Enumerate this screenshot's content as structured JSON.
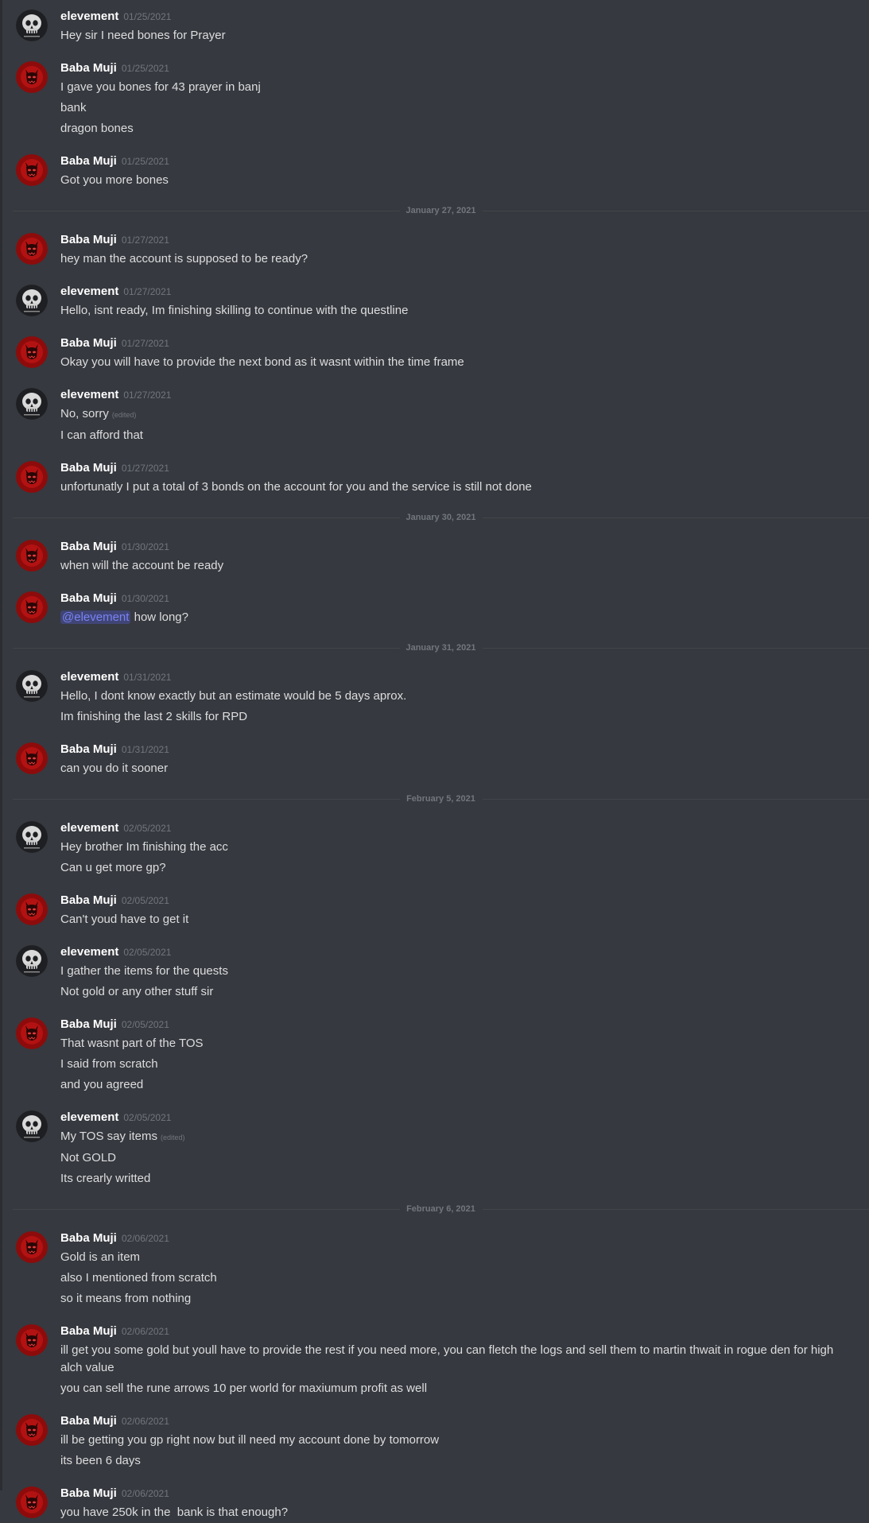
{
  "users": {
    "elevement": {
      "name": "elevement",
      "avatar": "skull-avatar"
    },
    "baba": {
      "name": "Baba Muji",
      "avatar": "red-demon-avatar"
    }
  },
  "colors": {
    "background": "#36393f",
    "username": "#ffffff",
    "message_text": "#dcddde",
    "timestamp": "#72767d",
    "mention": "#7983f5",
    "divider_line": "#42454a"
  },
  "feed": [
    {
      "type": "message",
      "user": "elevement",
      "timestamp": "01/25/2021",
      "lines": [
        {
          "text": "Hey sir I need bones for Prayer"
        }
      ]
    },
    {
      "type": "message",
      "user": "baba",
      "timestamp": "01/25/2021",
      "lines": [
        {
          "text": "I gave you bones for 43 prayer in banj"
        },
        {
          "text": "bank"
        },
        {
          "text": "dragon bones"
        }
      ]
    },
    {
      "type": "message",
      "user": "baba",
      "timestamp": "01/25/2021",
      "lines": [
        {
          "text": "Got you more bones"
        }
      ]
    },
    {
      "type": "divider",
      "label": "January 27, 2021"
    },
    {
      "type": "message",
      "user": "baba",
      "timestamp": "01/27/2021",
      "lines": [
        {
          "text": "hey man the account is supposed to be ready?"
        }
      ]
    },
    {
      "type": "message",
      "user": "elevement",
      "timestamp": "01/27/2021",
      "lines": [
        {
          "text": "Hello, isnt ready, Im finishing skilling to continue with the questline"
        }
      ]
    },
    {
      "type": "message",
      "user": "baba",
      "timestamp": "01/27/2021",
      "lines": [
        {
          "text": "Okay you will have to provide the next bond as it wasnt within the time frame"
        }
      ]
    },
    {
      "type": "message",
      "user": "elevement",
      "timestamp": "01/27/2021",
      "lines": [
        {
          "text": "No, sorry",
          "edited": "(edited)"
        },
        {
          "text": "I can afford that"
        }
      ]
    },
    {
      "type": "message",
      "user": "baba",
      "timestamp": "01/27/2021",
      "lines": [
        {
          "text": "unfortunatly I put a total of 3 bonds on the account for you and the service is still not done"
        }
      ]
    },
    {
      "type": "divider",
      "label": "January 30, 2021"
    },
    {
      "type": "message",
      "user": "baba",
      "timestamp": "01/30/2021",
      "lines": [
        {
          "text": "when will the account be ready"
        }
      ]
    },
    {
      "type": "message",
      "user": "baba",
      "timestamp": "01/30/2021",
      "lines": [
        {
          "mention": "@elevement",
          "text": " how long?"
        }
      ]
    },
    {
      "type": "divider",
      "label": "January 31, 2021"
    },
    {
      "type": "message",
      "user": "elevement",
      "timestamp": "01/31/2021",
      "lines": [
        {
          "text": "Hello, I dont know exactly but an estimate would be 5 days aprox."
        },
        {
          "text": "Im finishing the last 2 skills for RPD"
        }
      ]
    },
    {
      "type": "message",
      "user": "baba",
      "timestamp": "01/31/2021",
      "lines": [
        {
          "text": "can you do it sooner"
        }
      ]
    },
    {
      "type": "divider",
      "label": "February 5, 2021"
    },
    {
      "type": "message",
      "user": "elevement",
      "timestamp": "02/05/2021",
      "lines": [
        {
          "text": "Hey brother Im finishing the acc"
        },
        {
          "text": "Can u get more gp?"
        }
      ]
    },
    {
      "type": "message",
      "user": "baba",
      "timestamp": "02/05/2021",
      "lines": [
        {
          "text": "Can't youd have to get it"
        }
      ]
    },
    {
      "type": "message",
      "user": "elevement",
      "timestamp": "02/05/2021",
      "lines": [
        {
          "text": "I gather the items for the quests"
        },
        {
          "text": "Not gold or any other stuff sir"
        }
      ]
    },
    {
      "type": "message",
      "user": "baba",
      "timestamp": "02/05/2021",
      "lines": [
        {
          "text": "That wasnt part of the TOS"
        },
        {
          "text": "I said from scratch"
        },
        {
          "text": "and you agreed"
        }
      ]
    },
    {
      "type": "message",
      "user": "elevement",
      "timestamp": "02/05/2021",
      "lines": [
        {
          "text": "My TOS say items",
          "edited": "(edited)"
        },
        {
          "text": "Not GOLD"
        },
        {
          "text": "Its crearly writted"
        }
      ]
    },
    {
      "type": "divider",
      "label": "February 6, 2021"
    },
    {
      "type": "message",
      "user": "baba",
      "timestamp": "02/06/2021",
      "lines": [
        {
          "text": "Gold is an item"
        },
        {
          "text": "also I mentioned from scratch"
        },
        {
          "text": "so it means from nothing"
        }
      ]
    },
    {
      "type": "message",
      "user": "baba",
      "timestamp": "02/06/2021",
      "lines": [
        {
          "text": "ill get you some gold but youll have to provide the rest if you need more, you can fletch the logs and sell them to martin thwait in rogue den for high alch value"
        },
        {
          "text": "you can sell the rune arrows 10 per world for maxiumum profit as well"
        }
      ]
    },
    {
      "type": "message",
      "user": "baba",
      "timestamp": "02/06/2021",
      "lines": [
        {
          "text": "ill be getting you gp right now but ill need my account done by tomorrow"
        },
        {
          "text": "its been 6 days"
        }
      ]
    },
    {
      "type": "message",
      "user": "baba",
      "timestamp": "02/06/2021",
      "lines": [
        {
          "text": "you have 250k in the  bank is that enough?"
        }
      ]
    }
  ]
}
